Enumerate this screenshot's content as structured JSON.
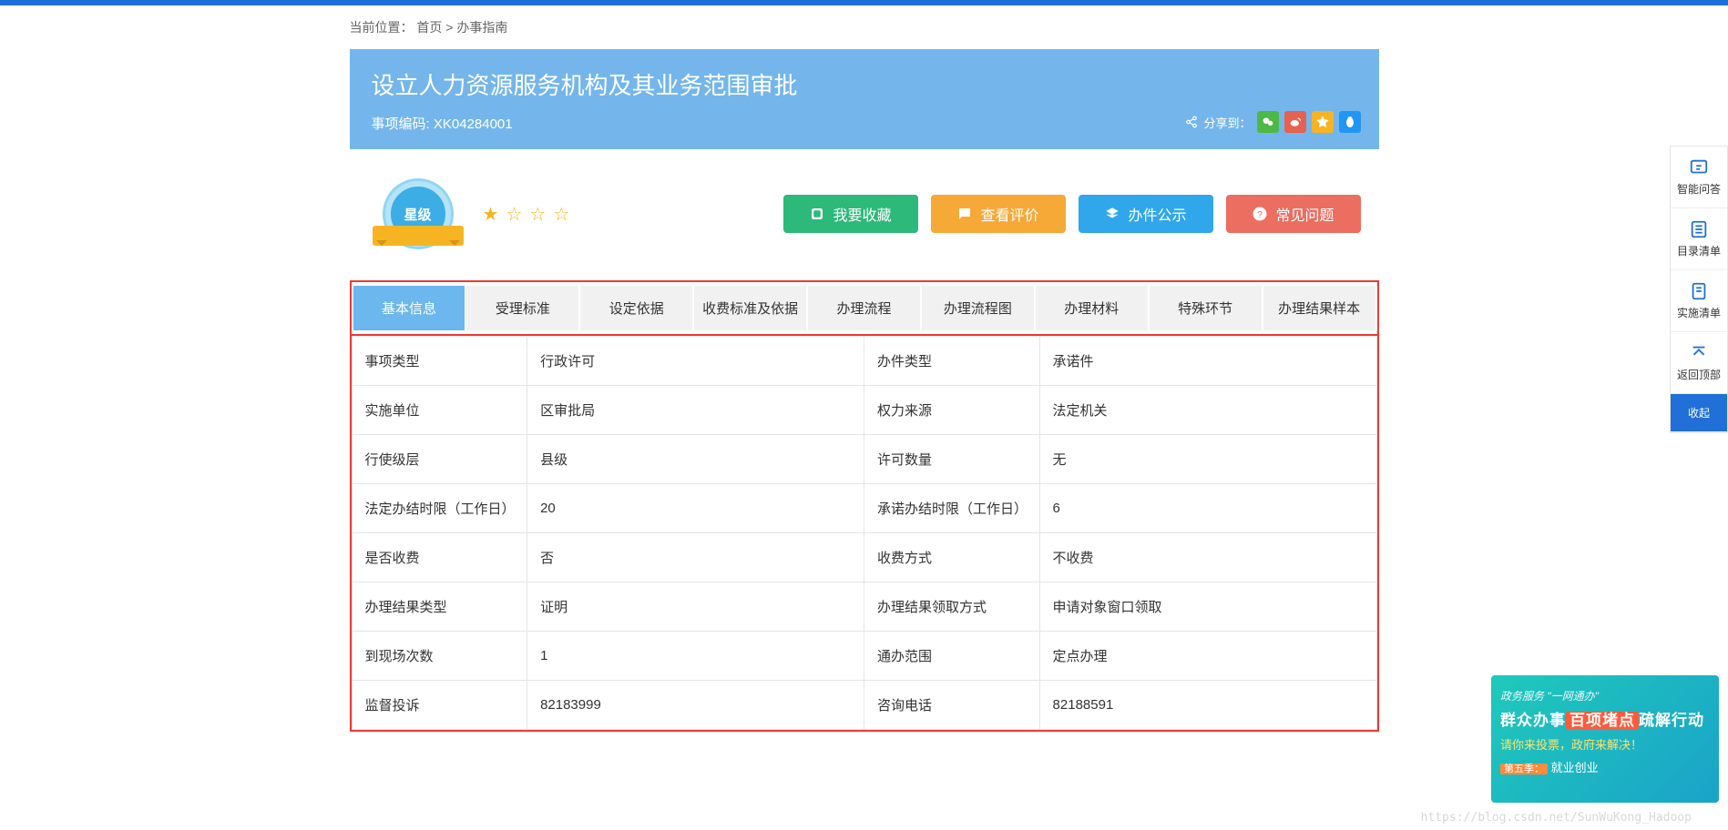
{
  "breadcrumb": {
    "label": "当前位置：",
    "home": "首页",
    "sep": ">",
    "current": "办事指南"
  },
  "header": {
    "title": "设立人力资源服务机构及其业务范围审批",
    "code_label": "事项编码:",
    "code": "XK04284001"
  },
  "share": {
    "label": "分享到："
  },
  "badge": {
    "text": "星级"
  },
  "buttons": {
    "fav": "我要收藏",
    "review": "查看评价",
    "publicity": "办件公示",
    "faq": "常见问题"
  },
  "tabs": [
    "基本信息",
    "受理标准",
    "设定依据",
    "收费标准及依据",
    "办理流程",
    "办理流程图",
    "办理材料",
    "特殊环节",
    "办理结果样本"
  ],
  "info_rows": [
    {
      "l1": "事项类型",
      "v1": "行政许可",
      "l2": "办件类型",
      "v2": "承诺件"
    },
    {
      "l1": "实施单位",
      "v1": "区审批局",
      "l2": "权力来源",
      "v2": "法定机关"
    },
    {
      "l1": "行使级层",
      "v1": "县级",
      "l2": "许可数量",
      "v2": "无"
    },
    {
      "l1": "法定办结时限（工作日）",
      "v1": "20",
      "l2": "承诺办结时限（工作日）",
      "v2": "6"
    },
    {
      "l1": "是否收费",
      "v1": "否",
      "l2": "收费方式",
      "v2": "不收费"
    },
    {
      "l1": "办理结果类型",
      "v1": "证明",
      "l2": "办理结果领取方式",
      "v2": "申请对象窗口领取"
    },
    {
      "l1": "到现场次数",
      "v1": "1",
      "l2": "通办范围",
      "v2": "定点办理"
    },
    {
      "l1": "监督投诉",
      "v1": "82183999",
      "l2": "咨询电话",
      "v2": "82188591"
    }
  ],
  "sidenav": {
    "qa": "智能问答",
    "catalog": "目录清单",
    "impl": "实施清单",
    "top": "返回顶部",
    "collapse": "收起"
  },
  "promo": {
    "line1": "政务服务 \"一网通办\"",
    "line2_a": "群众办事",
    "line2_hl": "百项堵点",
    "line2_b": "疏解行动",
    "line3": "请你来投票，政府来解决！",
    "line4_hl": "第五季：",
    "line4": "就业创业"
  },
  "watermark": "https://blog.csdn.net/SunWuKong_Hadoop"
}
